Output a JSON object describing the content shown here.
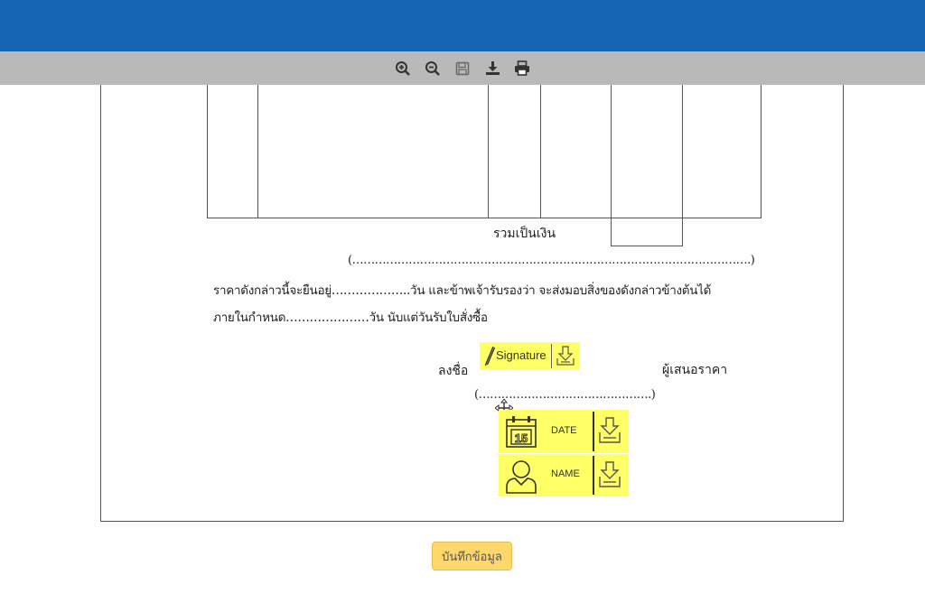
{
  "toolbar": {
    "tools": [
      "zoom-in-icon",
      "zoom-out-icon",
      "save-icon",
      "download-icon",
      "print-icon"
    ]
  },
  "document": {
    "total_label": "รวมเป็นเงิน",
    "amount_words_line": "(…………………………………………………………………………………………….)",
    "price_line_1": "ราคาดังกล่าวนี้จะยืนอยู่………………..วัน และข้าพเจ้ารับรองว่า จะส่งมอบสิ่งของดังกล่าวข้างต้นได้",
    "price_line_2": "ภายในกำหนด…………………วัน นับแต่วันรับใบสั่งซื้อ",
    "sign_label": "ลงชื่อ",
    "bidder_label": "ผู้เสนอราคา",
    "name_paren_line": "(……………………………………….)"
  },
  "fields": {
    "signature_label": "Signature",
    "date_label": "DATE",
    "date_icon_number": "15",
    "name_label": "NAME"
  },
  "actions": {
    "save_label": "บันทึกข้อมูล"
  },
  "colors": {
    "header": "#1565b2",
    "toolbar": "#b9b9b9",
    "field_highlight": "#ffff66",
    "save_button": "#ffd76b"
  }
}
